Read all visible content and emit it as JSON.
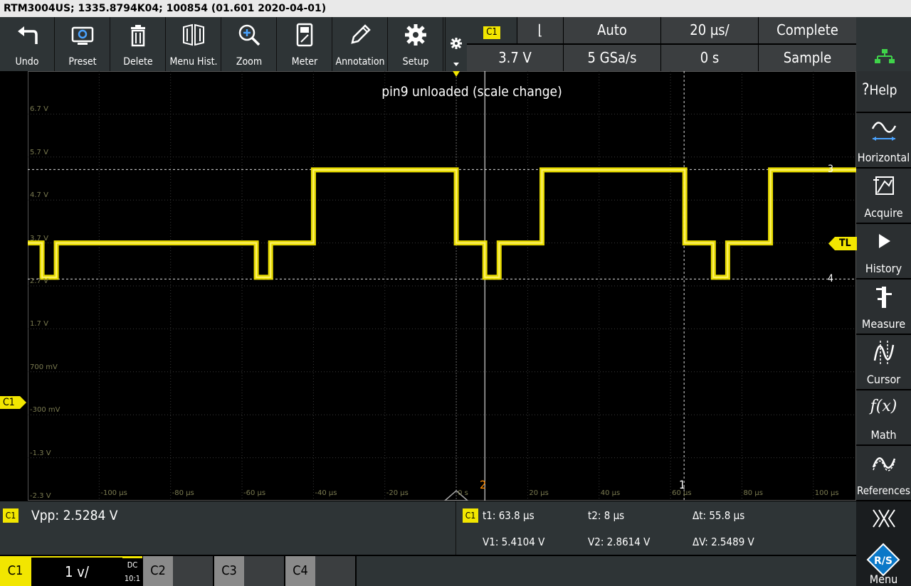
{
  "window": {
    "title": "RTM3004US; 1335.8794K04; 100854 (01.601 2020-04-01)"
  },
  "toolbar": {
    "buttons": [
      {
        "label": "Undo",
        "icon": "undo-icon"
      },
      {
        "label": "Preset",
        "icon": "preset-icon"
      },
      {
        "label": "Delete",
        "icon": "trash-icon"
      },
      {
        "label": "Menu Hist.",
        "icon": "menu-history-icon"
      },
      {
        "label": "Zoom",
        "icon": "zoom-icon"
      },
      {
        "label": "Meter",
        "icon": "meter-icon"
      },
      {
        "label": "Annotation",
        "icon": "pencil-icon"
      },
      {
        "label": "Setup",
        "icon": "gear-icon"
      }
    ]
  },
  "trigger": {
    "source": "C1",
    "slope_symbol": "⌊",
    "mode": "Auto",
    "timebase": "20 µs/",
    "acq_state": "Complete",
    "level": "3.7 V",
    "sample_rate": "5 GSa/s",
    "offset": "0 s",
    "acq_mode": "Sample"
  },
  "sidebar": {
    "items": [
      {
        "label": "Help",
        "icon": "help-icon",
        "prefix": "?"
      },
      {
        "label": "Horizontal",
        "icon": "horizontal-icon"
      },
      {
        "label": "Acquire",
        "icon": "acquire-icon"
      },
      {
        "label": "History",
        "icon": "history-play-icon"
      },
      {
        "label": "Measure",
        "icon": "measure-icon"
      },
      {
        "label": "Cursor",
        "icon": "cursor-icon"
      },
      {
        "label": "Math",
        "icon": "math-icon",
        "symbol": "f(x)"
      },
      {
        "label": "References",
        "icon": "references-icon"
      },
      {
        "label": "Menu",
        "icon": "rs-logo-icon"
      }
    ]
  },
  "display": {
    "annotation": "pin9 unloaded (scale change)",
    "ytick_labels": [
      "6.7 V",
      "5.7 V",
      "4.7 V",
      "3.7 V",
      "2.7 V",
      "1.7 V",
      "700 mV",
      "-300 mV",
      "-1.3 V",
      "-2.3 V"
    ],
    "xtick_labels": [
      "-100 µs",
      "-80 µs",
      "-60 µs",
      "-40 µs",
      "-20 µs",
      "0 s",
      "20 µs",
      "40 µs",
      "60 µs",
      "80 µs",
      "100 µs"
    ],
    "channel_marker": "C1",
    "trigger_marker": "TL",
    "cursor_labels": {
      "h1": "3",
      "h2": "4",
      "v1": "2",
      "v2": "1"
    },
    "colors": {
      "trace": "#f2e600",
      "cursor2": "#ff8a00",
      "grid": "#3a3a3a"
    }
  },
  "chart_data": {
    "type": "line",
    "title": "pin9 unloaded (scale change)",
    "xlabel": "",
    "ylabel": "",
    "xlim": [
      -120,
      112
    ],
    "ylim": [
      -2.3,
      7.7
    ],
    "series": [
      {
        "x": [
          -120,
          -116,
          -116,
          -112,
          -112,
          -56,
          -56,
          -52,
          -52,
          -40,
          -40,
          0,
          0,
          8,
          8,
          12,
          12,
          24,
          24,
          64,
          64,
          72,
          72,
          76,
          76,
          88,
          88,
          112
        ],
        "y": [
          3.7,
          3.7,
          2.9,
          2.9,
          3.7,
          3.7,
          2.9,
          2.9,
          3.7,
          3.7,
          5.4,
          5.4,
          3.7,
          3.7,
          2.9,
          2.9,
          3.7,
          3.7,
          5.4,
          5.4,
          3.7,
          3.7,
          2.9,
          2.9,
          3.7,
          3.7,
          5.4,
          5.4
        ]
      }
    ]
  },
  "measurement": {
    "channel": "C1",
    "vpp": "Vpp: 2.5284 V"
  },
  "cursors": {
    "channel": "C1",
    "t1": "t1: 63.8 µs",
    "t2": "t2: 8 µs",
    "dt": "Δt: 55.8 µs",
    "v1": "V1: 5.4104 V",
    "v2": "V2: 2.8614 V",
    "dv": "ΔV: 2.5489 V"
  },
  "channels": {
    "c1": {
      "label": "C1",
      "scale": "1 v/",
      "coupling": "DC",
      "probe": "10:1"
    },
    "c2": {
      "label": "C2"
    },
    "c3": {
      "label": "C3"
    },
    "c4": {
      "label": "C4"
    }
  }
}
